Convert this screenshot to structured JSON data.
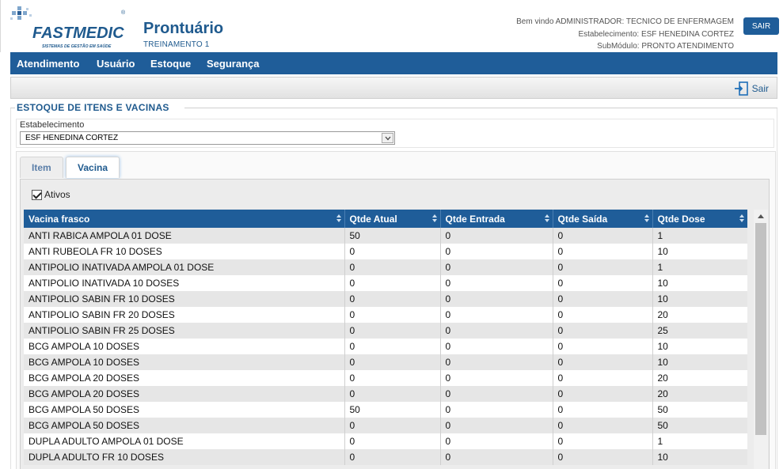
{
  "header": {
    "logo_text": "FASTMEDIC",
    "logo_tagline": "SISTEMAS DE GESTÃO EM SAÚDE",
    "title": "Prontuário",
    "subtitle": "TREINAMENTO 1",
    "welcome": "Bem vindo ADMINISTRADOR: TECNICO DE ENFERMAGEM",
    "establishment": "Estabelecimento: ESF HENEDINA CORTEZ",
    "submodule": "SubMódulo: PRONTO ATENDIMENTO",
    "logout_label": "SAIR"
  },
  "menu": {
    "items": [
      {
        "label": "Atendimento"
      },
      {
        "label": "Usuário"
      },
      {
        "label": "Estoque"
      },
      {
        "label": "Segurança"
      }
    ]
  },
  "toolbar": {
    "exit_label": "Sair"
  },
  "section": {
    "title": "ESTOQUE DE ITENS E VACINAS",
    "establishment_label": "Estabelecimento",
    "establishment_value": "ESF HENEDINA CORTEZ"
  },
  "tabs": [
    {
      "label": "Item",
      "active": false
    },
    {
      "label": "Vacina",
      "active": true
    }
  ],
  "filter": {
    "ativos_label": "Ativos",
    "ativos_checked": true
  },
  "grid": {
    "columns": [
      "Vacina frasco",
      "Qtde Atual",
      "Qtde Entrada",
      "Qtde Saída",
      "Qtde Dose"
    ],
    "rows": [
      [
        "ANTI RABICA AMPOLA 01 DOSE",
        "50",
        "0",
        "0",
        "1"
      ],
      [
        "ANTI RUBEOLA FR 10 DOSES",
        "0",
        "0",
        "0",
        "10"
      ],
      [
        "ANTIPOLIO INATIVADA AMPOLA 01 DOSE",
        "0",
        "0",
        "0",
        "1"
      ],
      [
        "ANTIPOLIO INATIVADA 10 DOSES",
        "0",
        "0",
        "0",
        "10"
      ],
      [
        "ANTIPOLIO SABIN FR 10 DOSES",
        "0",
        "0",
        "0",
        "10"
      ],
      [
        "ANTIPOLIO SABIN FR 20 DOSES",
        "0",
        "0",
        "0",
        "20"
      ],
      [
        "ANTIPOLIO SABIN FR 25 DOSES",
        "0",
        "0",
        "0",
        "25"
      ],
      [
        "BCG AMPOLA 10 DOSES",
        "0",
        "0",
        "0",
        "10"
      ],
      [
        "BCG AMPOLA 10 DOSES",
        "0",
        "0",
        "0",
        "10"
      ],
      [
        "BCG AMPOLA 20 DOSES",
        "0",
        "0",
        "0",
        "20"
      ],
      [
        "BCG AMPOLA 20 DOSES",
        "0",
        "0",
        "0",
        "20"
      ],
      [
        "BCG AMPOLA 50 DOSES",
        "50",
        "0",
        "0",
        "50"
      ],
      [
        "BCG AMPOLA 50 DOSES",
        "0",
        "0",
        "0",
        "50"
      ],
      [
        "DUPLA ADULTO AMPOLA 01 DOSE",
        "0",
        "0",
        "0",
        "1"
      ],
      [
        "DUPLA ADULTO FR 10 DOSES",
        "0",
        "0",
        "0",
        "10"
      ]
    ]
  },
  "colors": {
    "primary": "#1f5d99",
    "title_text": "#1f5a8e",
    "row_alt": "#e6e6e6"
  }
}
